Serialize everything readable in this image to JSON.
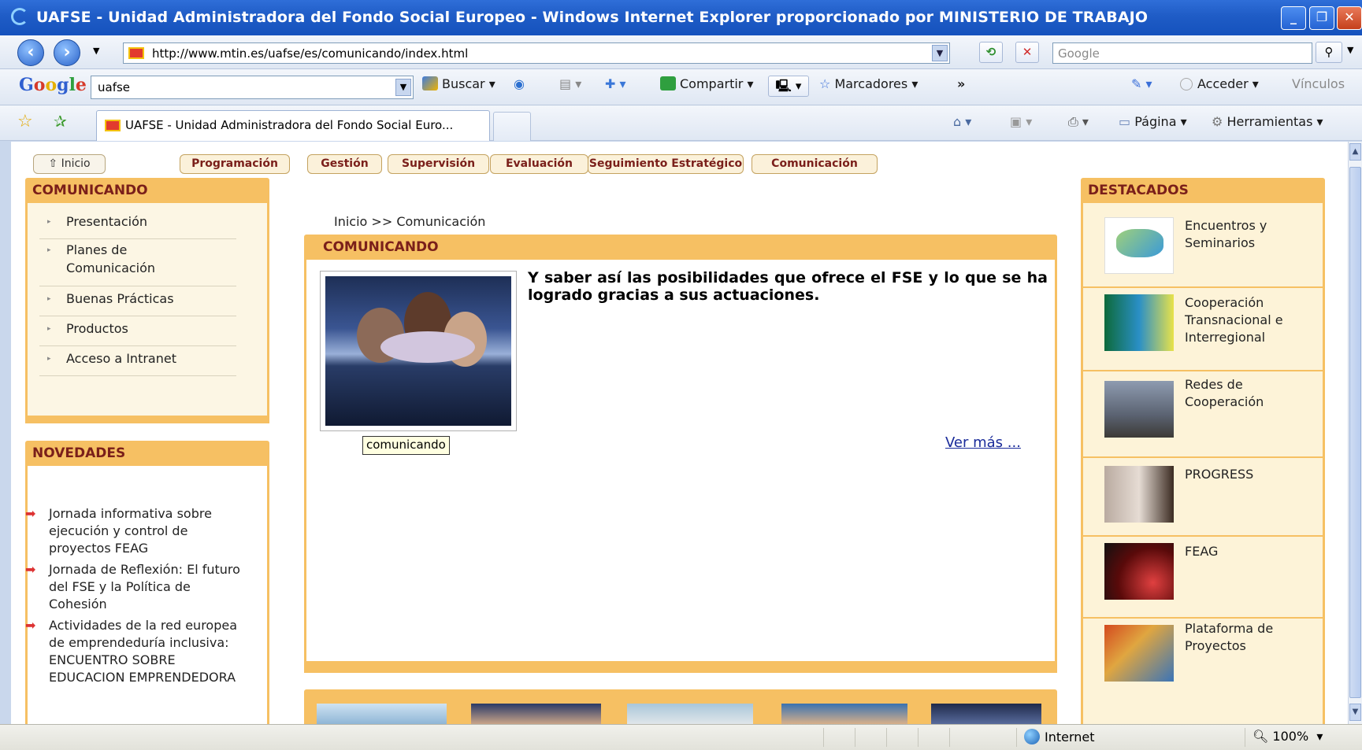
{
  "window": {
    "title": "UAFSE - Unidad Administradora del Fondo Social Europeo - Windows Internet Explorer proporcionado por MINISTERIO DE TRABAJO",
    "minimize": "_",
    "maximize": "❐",
    "close": "✕"
  },
  "address_bar": {
    "url": "http://www.mtin.es/uafse/es/comunicando/index.html",
    "search_placeholder": "Google"
  },
  "google_toolbar": {
    "logo": "Google",
    "query": "uafse",
    "buscar": "Buscar",
    "compartir": "Compartir",
    "marcadores": "Marcadores",
    "more": "»",
    "acceder": "Acceder",
    "vinculos": "Vínculos"
  },
  "tabs": {
    "active_title": "UAFSE - Unidad Administradora del Fondo Social Euro...",
    "pagina": "Página",
    "herramientas": "Herramientas"
  },
  "top_menu": {
    "inicio": "Inicio",
    "items": [
      "Programación",
      "Gestión",
      "Supervisión",
      "Evaluación",
      "Seguimiento Estratégico",
      "Comunicación"
    ]
  },
  "left": {
    "comunicando_title": "COMUNICANDO",
    "nav": [
      "Presentación",
      "Planes de Comunicación",
      "Buenas Prácticas",
      "Productos",
      "Acceso a Intranet"
    ],
    "novedades_title": "NOVEDADES",
    "news": [
      "Jornada informativa sobre ejecución y control de proyectos FEAG",
      "Jornada de Reflexión: El futuro del FSE y la Política de Cohesión",
      "Actividades de la red europea de emprendeduría inclusiva: ENCUENTRO SOBRE EDUCACION EMPRENDEDORA"
    ]
  },
  "center": {
    "breadcrumb": "Inicio >> Comunicación",
    "section_title": "COMUNICANDO",
    "image_caption": "comunicando",
    "lead_text": "Y saber así las posibilidades que ofrece el FSE y lo que se ha logrado gracias a sus actuaciones.",
    "ver_mas": "Ver más ..."
  },
  "right": {
    "title": "DESTACADOS",
    "items": [
      "Encuentros y Seminarios",
      "Cooperación Transnacional e Interregional",
      "Redes de Cooperación",
      "PROGRESS",
      "FEAG",
      "Plataforma de Proyectos"
    ]
  },
  "status_bar": {
    "zone": "Internet",
    "zoom": "100%"
  },
  "colors": {
    "accent_orange": "#f6c063",
    "heading_red": "#7a1f1a",
    "link_blue": "#1a2b9a",
    "ie_title_blue": "#1f5cc6"
  }
}
